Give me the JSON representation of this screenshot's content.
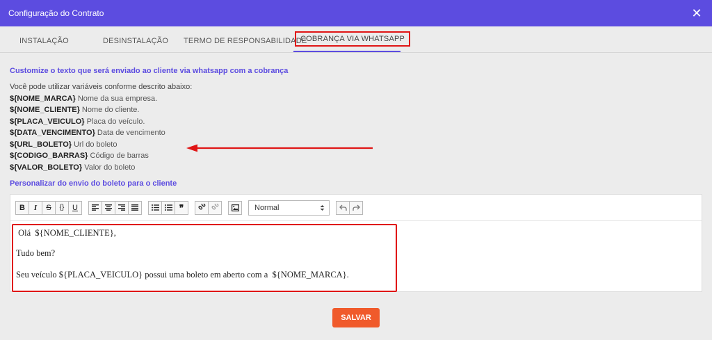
{
  "header": {
    "title": "Configuração do Contrato",
    "close_icon": "✕"
  },
  "tabs": [
    {
      "label": "INSTALAÇÃO"
    },
    {
      "label": "DESINSTALAÇÃO"
    },
    {
      "label": "TERMO DE RESPONSABILIDADE"
    },
    {
      "label": "COBRANÇA VIA WHATSAPP",
      "active": true
    }
  ],
  "content": {
    "section_title": "Customize o texto que será enviado ao cliente via whatsapp com a cobrança",
    "intro": "Você pode utilizar variáveis conforme descrito abaixo:",
    "variables": [
      {
        "name": "${NOME_MARCA}",
        "desc": "Nome da sua empresa."
      },
      {
        "name": "${NOME_CLIENTE}",
        "desc": "Nome do cliente."
      },
      {
        "name": "${PLACA_VEICULO}",
        "desc": "Placa do veículo."
      },
      {
        "name": "${DATA_VENCIMENTO}",
        "desc": "Data de vencimento"
      },
      {
        "name": "${URL_BOLETO}",
        "desc": "Url do boleto"
      },
      {
        "name": "${CODIGO_BARRAS}",
        "desc": "Código de barras"
      },
      {
        "name": "${VALOR_BOLETO}",
        "desc": "Valor do boleto"
      }
    ],
    "section_title2": "Personalizar do envio do boleto para o cliente"
  },
  "editor": {
    "toolbar": {
      "bold": "B",
      "italic": "I",
      "strike": "S",
      "code": "{}",
      "underline": "U",
      "quote": "❞",
      "format_select": "Normal"
    },
    "lines": [
      " Olá  ${NOME_CLIENTE},",
      "Tudo bem?",
      "Seu veículo ${PLACA_VEICULO} possui uma boleto em aberto com a  ${NOME_MARCA}."
    ]
  },
  "footer": {
    "save_label": "SALVAR"
  },
  "colors": {
    "header": "#5c4ce0",
    "accent": "#5c4ce0",
    "highlight": "#e01515",
    "save": "#f05a2b"
  }
}
